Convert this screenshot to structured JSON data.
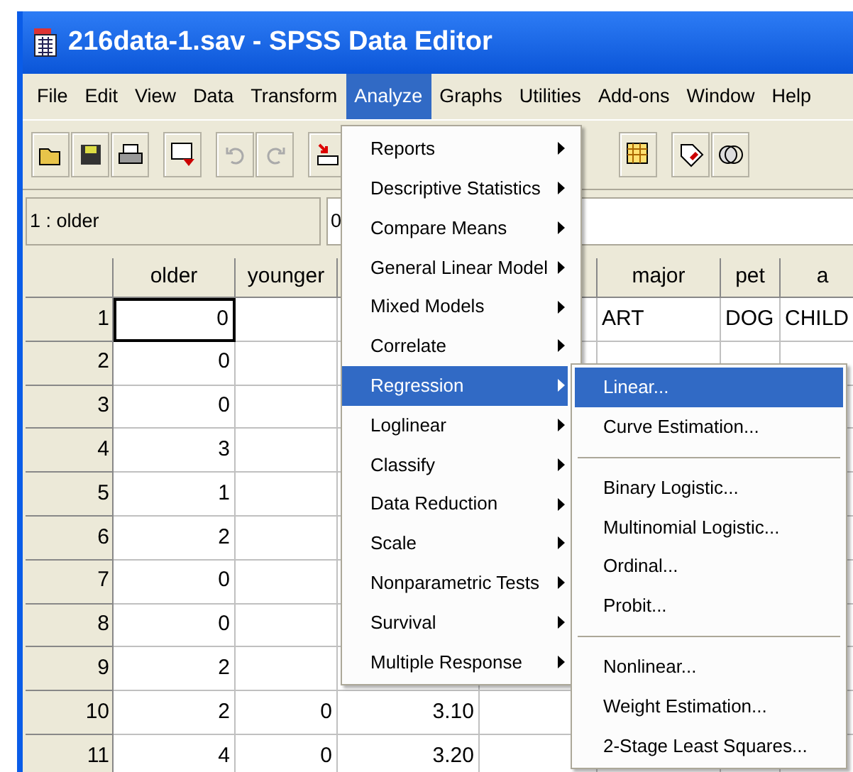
{
  "window": {
    "title": "216data-1.sav - SPSS Data Editor"
  },
  "menu_bar": [
    {
      "label": "File",
      "selected": false
    },
    {
      "label": "Edit",
      "selected": false
    },
    {
      "label": "View",
      "selected": false
    },
    {
      "label": "Data",
      "selected": false
    },
    {
      "label": "Transform",
      "selected": false
    },
    {
      "label": "Analyze",
      "selected": true
    },
    {
      "label": "Graphs",
      "selected": false
    },
    {
      "label": "Utilities",
      "selected": false
    },
    {
      "label": "Add-ons",
      "selected": false
    },
    {
      "label": "Window",
      "selected": false
    },
    {
      "label": "Help",
      "selected": false
    }
  ],
  "cell_editor": {
    "name": "1 : older",
    "value": "0"
  },
  "grid": {
    "columns": [
      "older",
      "younger",
      null,
      null,
      "major",
      "pet",
      "a"
    ],
    "rows": [
      {
        "number": "1",
        "active": true,
        "cells": [
          "0",
          null,
          null,
          null,
          "ART",
          "DOG",
          "CHILD"
        ]
      },
      {
        "number": "2",
        "active": false,
        "cells": [
          "0"
        ]
      },
      {
        "number": "3",
        "active": false,
        "cells": [
          "0"
        ]
      },
      {
        "number": "4",
        "active": false,
        "cells": [
          "3"
        ]
      },
      {
        "number": "5",
        "active": false,
        "cells": [
          "1"
        ]
      },
      {
        "number": "6",
        "active": false,
        "cells": [
          "2"
        ]
      },
      {
        "number": "7",
        "active": false,
        "cells": [
          "0"
        ]
      },
      {
        "number": "8",
        "active": false,
        "cells": [
          "0"
        ]
      },
      {
        "number": "9",
        "active": false,
        "cells": [
          "2"
        ]
      },
      {
        "number": "10",
        "active": false,
        "cells": [
          "2",
          "0",
          "3.10"
        ]
      },
      {
        "number": "11",
        "active": false,
        "cells": [
          "4",
          "0",
          "3.20"
        ]
      }
    ]
  },
  "analyze_menu": [
    {
      "label": "Reports",
      "selected": false
    },
    {
      "label": "Descriptive Statistics",
      "selected": false
    },
    {
      "label": "Compare Means",
      "selected": false
    },
    {
      "label": "General Linear Model",
      "selected": false
    },
    {
      "label": "Mixed Models",
      "selected": false
    },
    {
      "label": "Correlate",
      "selected": false
    },
    {
      "label": "Regression",
      "selected": true
    },
    {
      "label": "Loglinear",
      "selected": false
    },
    {
      "label": "Classify",
      "selected": false
    },
    {
      "label": "Data Reduction",
      "selected": false
    },
    {
      "label": "Scale",
      "selected": false
    },
    {
      "label": "Nonparametric Tests",
      "selected": false
    },
    {
      "label": "Survival",
      "selected": false
    },
    {
      "label": "Multiple Response",
      "selected": false
    }
  ],
  "regression_submenu": [
    [
      {
        "label": "Linear...",
        "selected": true
      },
      {
        "label": "Curve Estimation...",
        "selected": false
      }
    ],
    [
      {
        "label": "Binary Logistic...",
        "selected": false
      },
      {
        "label": "Multinomial Logistic...",
        "selected": false
      },
      {
        "label": "Ordinal...",
        "selected": false
      },
      {
        "label": "Probit...",
        "selected": false
      }
    ],
    [
      {
        "label": "Nonlinear...",
        "selected": false
      },
      {
        "label": "Weight Estimation...",
        "selected": false
      },
      {
        "label": "2-Stage Least Squares...",
        "selected": false
      }
    ]
  ]
}
